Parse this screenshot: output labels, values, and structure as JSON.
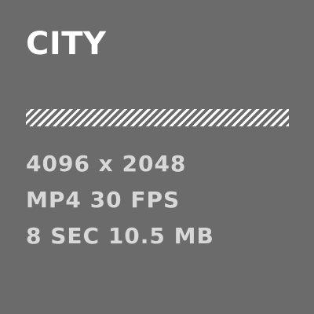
{
  "title": "CITY",
  "specs": {
    "resolution": "4096 x 2048",
    "format": "MP4 30 FPS",
    "duration_size": "8 SEC 10.5 MB"
  },
  "colors": {
    "background": "#6b6b6b",
    "title": "#ffffff",
    "specs_text": "#d8d8d8",
    "divider": "#ffffff"
  }
}
